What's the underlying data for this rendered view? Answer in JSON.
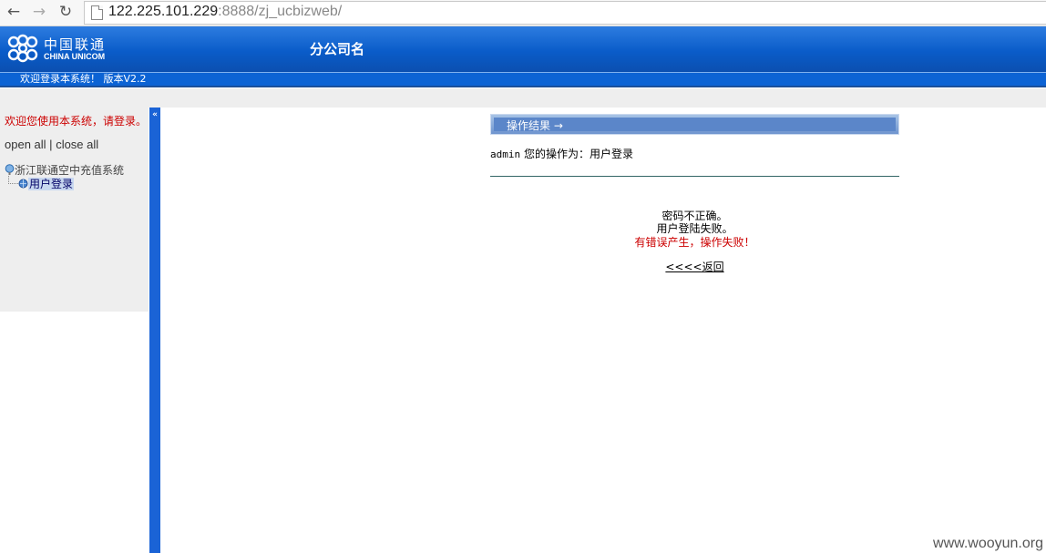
{
  "browser": {
    "url_host": "122.225.101.229",
    "url_rest": ":8888/zj_ucbizweb/"
  },
  "header": {
    "logo_cn": "中国联通",
    "logo_en": "CHINA UNICOM",
    "branch_title": "分公司名",
    "welcome": "欢迎登录本系统！ 版本V2.2"
  },
  "sidebar": {
    "welcome": "欢迎您使用本系统，请登录。",
    "open_all": "open all",
    "separator": "|",
    "close_all": "close all",
    "tree": {
      "root_label": "浙江联通空中充值系统",
      "child_label": "用户登录"
    }
  },
  "main": {
    "result_title": "操作结果 →",
    "user": "admin",
    "op_prefix": "您的操作为：",
    "op_name": "用户登录",
    "messages": [
      "密码不正确。",
      "用户登陆失败。"
    ],
    "error_message": "有错误产生，操作失败！",
    "back_link": "<<<<返回"
  },
  "watermark": "www.wooyun.org",
  "colors": {
    "header_blue": "#0a5cc9",
    "splitter_blue": "#1a63d6",
    "error_red": "#cc0000"
  }
}
